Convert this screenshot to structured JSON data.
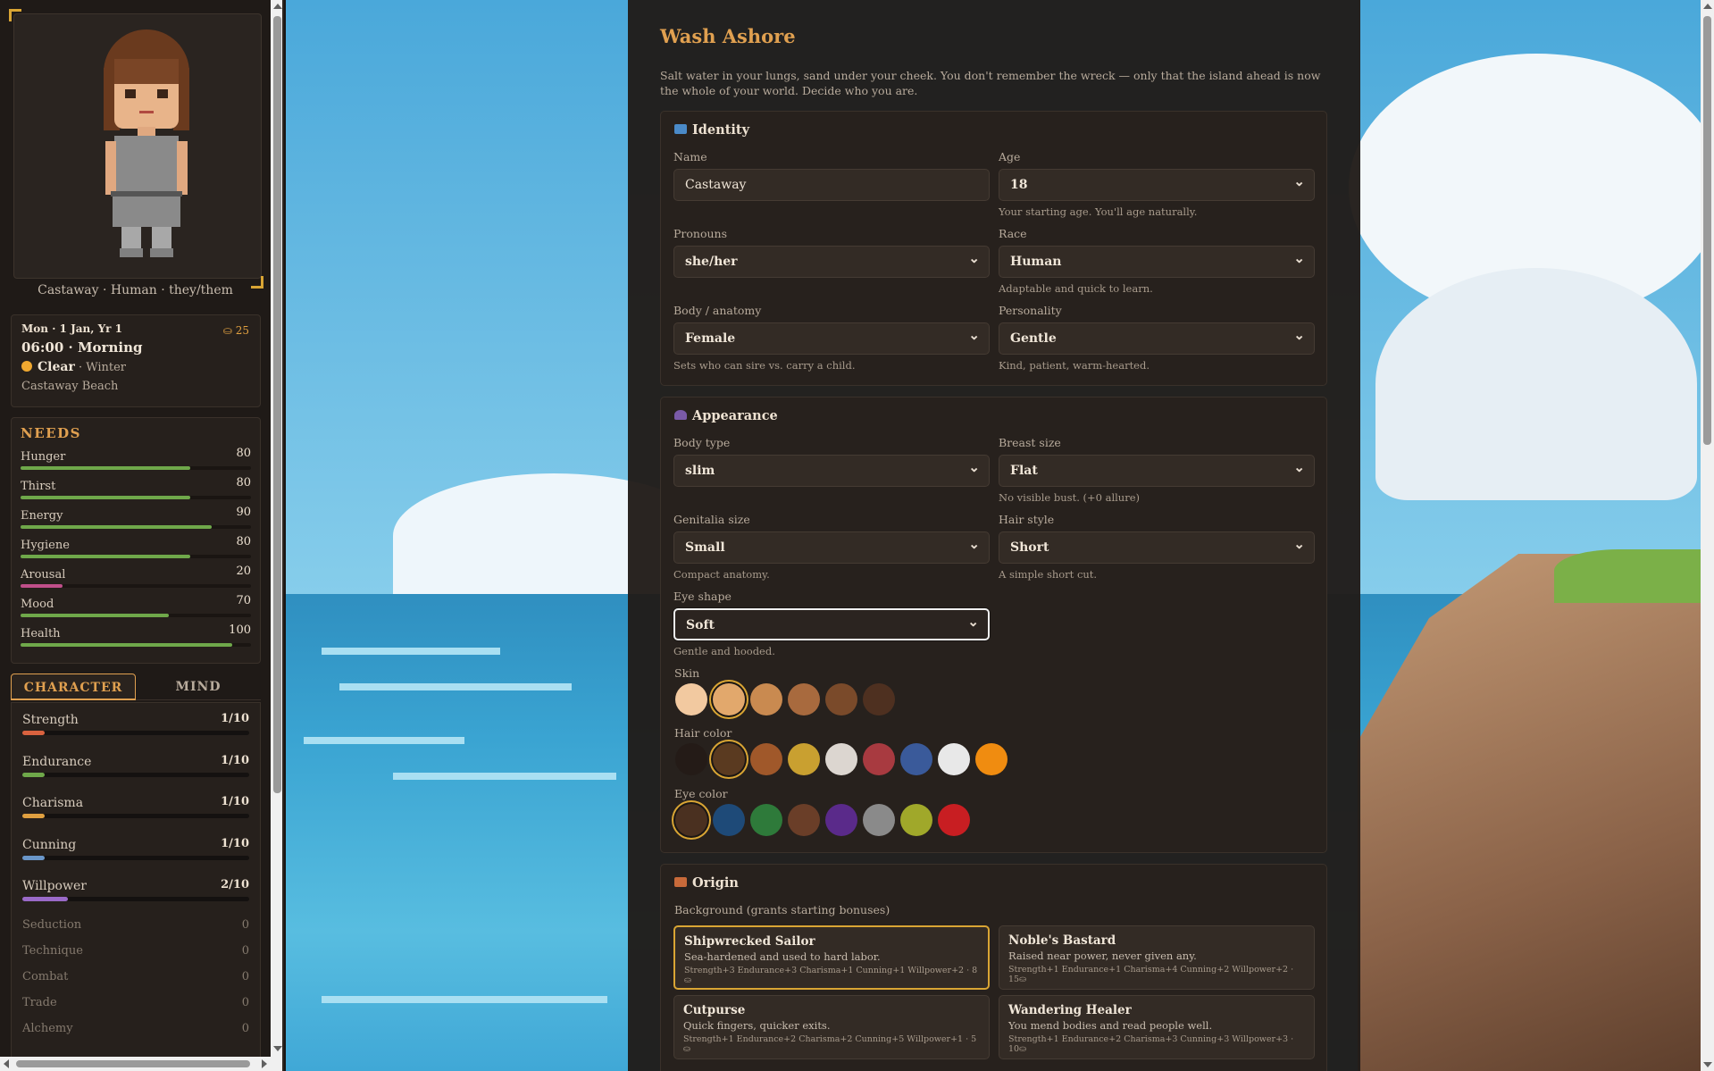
{
  "sidebar": {
    "caption": "Castaway · Human · they/them",
    "time": {
      "date": "Mon · 1 Jan, Yr 1",
      "coins": "25",
      "clock": "06:00 · Morning",
      "weather": "Clear",
      "season": " · Winter",
      "location": "Castaway Beach"
    },
    "needs": {
      "title": "NEEDS",
      "items": [
        {
          "label": "Hunger",
          "value": "80",
          "fraction": 0.8,
          "color": "#6fa84a"
        },
        {
          "label": "Thirst",
          "value": "80",
          "fraction": 0.8,
          "color": "#6fa84a"
        },
        {
          "label": "Energy",
          "value": "90",
          "fraction": 0.9,
          "color": "#6fa84a"
        },
        {
          "label": "Hygiene",
          "value": "80",
          "fraction": 0.8,
          "color": "#6fa84a"
        },
        {
          "label": "Arousal",
          "value": "20",
          "fraction": 0.2,
          "color": "#c04f8a"
        },
        {
          "label": "Mood",
          "value": "70",
          "fraction": 0.7,
          "color": "#6fa84a"
        },
        {
          "label": "Health",
          "value": "100",
          "fraction": 1.0,
          "color": "#6fa84a"
        }
      ]
    },
    "tabs": {
      "character": "CHARACTER",
      "mind": "MIND"
    },
    "stats": [
      {
        "label": "Strength",
        "value": "1/10",
        "fraction": 0.1,
        "color": "#d9623f"
      },
      {
        "label": "Endurance",
        "value": "1/10",
        "fraction": 0.1,
        "color": "#6fa84a"
      },
      {
        "label": "Charisma",
        "value": "1/10",
        "fraction": 0.1,
        "color": "#e0a040"
      },
      {
        "label": "Cunning",
        "value": "1/10",
        "fraction": 0.1,
        "color": "#6a96c8"
      },
      {
        "label": "Willpower",
        "value": "2/10",
        "fraction": 0.2,
        "color": "#9a6ac8"
      }
    ],
    "skills": [
      {
        "label": "Seduction",
        "value": "0"
      },
      {
        "label": "Technique",
        "value": "0"
      },
      {
        "label": "Combat",
        "value": "0"
      },
      {
        "label": "Trade",
        "value": "0"
      },
      {
        "label": "Alchemy",
        "value": "0"
      }
    ]
  },
  "main": {
    "title": "Wash Ashore",
    "intro": "Salt water in your lungs, sand under your cheek. You don't remember the wreck — only that the island ahead is now the whole of your world. Decide who you are.",
    "identity": {
      "title": "Identity",
      "name_label": "Name",
      "name_value": "Castaway",
      "age_label": "Age",
      "age_value": "18",
      "age_hint": "Your starting age. You'll age naturally.",
      "pronouns_label": "Pronouns",
      "pronouns_value": "she/her",
      "race_label": "Race",
      "race_value": "Human",
      "race_hint": "Adaptable and quick to learn.",
      "body_label": "Body / anatomy",
      "body_value": "Female",
      "body_hint": "Sets who can sire vs. carry a child.",
      "personality_label": "Personality",
      "personality_value": "Gentle",
      "personality_hint": "Kind, patient, warm-hearted."
    },
    "appearance": {
      "title": "Appearance",
      "bodytype_label": "Body type",
      "bodytype_value": "slim",
      "breast_label": "Breast size",
      "breast_value": "Flat",
      "breast_hint": "No visible bust. (+0 allure)",
      "genital_label": "Genitalia size",
      "genital_value": "Small",
      "genital_hint": "Compact anatomy.",
      "hair_label": "Hair style",
      "hair_value": "Short",
      "hair_hint": "A simple short cut.",
      "eye_label": "Eye shape",
      "eye_value": "Soft",
      "eye_hint": "Gentle and hooded.",
      "skin_label": "Skin",
      "skin_colors": [
        "#f2c9a0",
        "#e2a86c",
        "#c98a50",
        "#a86a3e",
        "#7a4a2a",
        "#4e3020"
      ],
      "hair_color_label": "Hair color",
      "hair_colors": [
        "#241b17",
        "#5a3a20",
        "#a0582a",
        "#c9a030",
        "#dcd6d0",
        "#a83a40",
        "#3a5a9a",
        "#e8e8e8",
        "#f08c10"
      ],
      "eye_color_label": "Eye color",
      "eye_colors": [
        "#4a3020",
        "#1e4a78",
        "#2e7a3a",
        "#6a3e28",
        "#5a2a8a",
        "#8a8a8a",
        "#a0a82a",
        "#c81e22"
      ]
    },
    "origin": {
      "title": "Origin",
      "subtitle": "Background (grants starting bonuses)",
      "cards": [
        {
          "title": "Shipwrecked Sailor",
          "desc": "Sea-hardened and used to hard labor.",
          "bonus": "Strength+3 Endurance+3 Charisma+1 Cunning+1 Willpower+2 · 8⛀"
        },
        {
          "title": "Noble's Bastard",
          "desc": "Raised near power, never given any.",
          "bonus": "Strength+1 Endurance+1 Charisma+4 Cunning+2 Willpower+2 · 15⛀"
        },
        {
          "title": "Cutpurse",
          "desc": "Quick fingers, quicker exits.",
          "bonus": "Strength+1 Endurance+2 Charisma+2 Cunning+5 Willpower+1 · 5⛀"
        },
        {
          "title": "Wandering Healer",
          "desc": "You mend bodies and read people well.",
          "bonus": "Strength+1 Endurance+2 Charisma+3 Cunning+3 Willpower+3 · 10⛀"
        }
      ]
    }
  }
}
